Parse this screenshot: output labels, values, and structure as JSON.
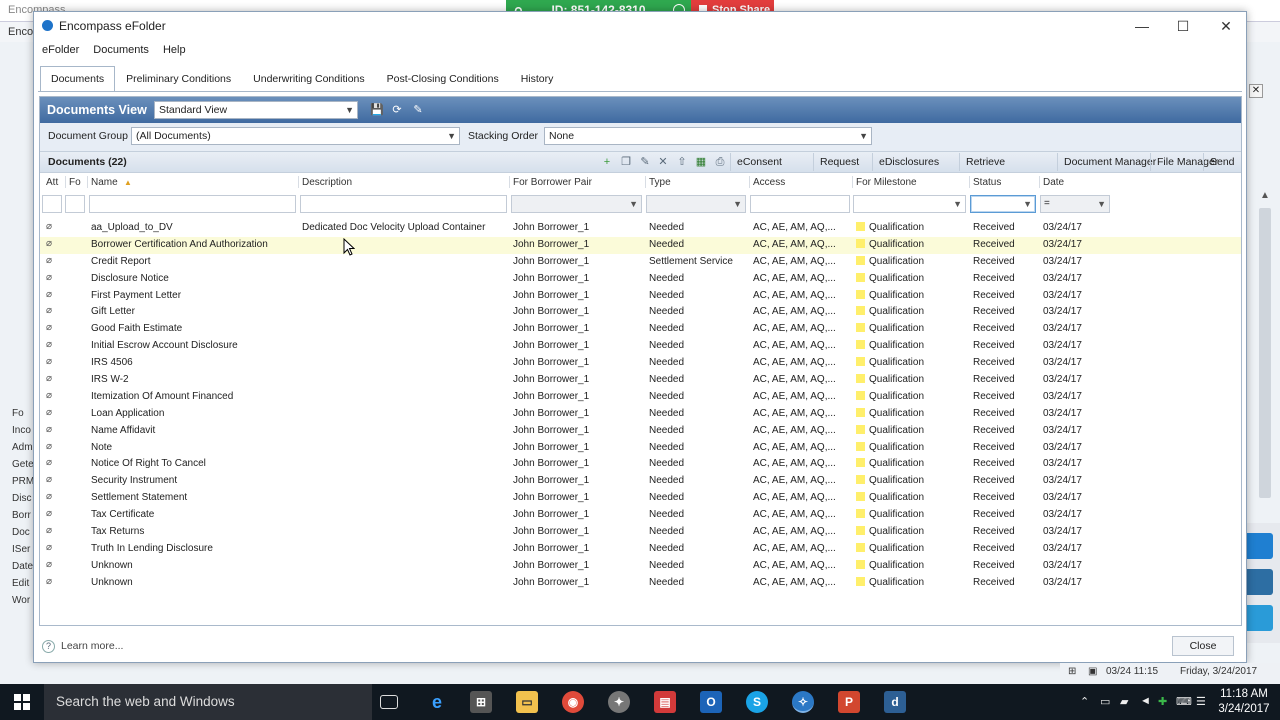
{
  "background": {
    "title": "Encompass",
    "menu_first": "Enco",
    "side_items": [
      "Fo",
      "Inco",
      "Adm",
      "Gete",
      "PRM",
      "Disc",
      "Borr",
      "Doc",
      "ISer",
      "Date",
      "Edit",
      "Wor"
    ]
  },
  "share": {
    "id_label": "ID: 851-142-8310",
    "stop_label": "Stop Share"
  },
  "window": {
    "title": "Encompass eFolder",
    "menu": [
      "eFolder",
      "Documents",
      "Help"
    ],
    "tabs": [
      "Documents",
      "Preliminary Conditions",
      "Underwriting Conditions",
      "Post-Closing Conditions",
      "History"
    ]
  },
  "documents_view": {
    "title": "Documents View",
    "view_select": "Standard View",
    "document_group_label": "Document Group",
    "document_group_value": "(All Documents)",
    "stacking_order_label": "Stacking Order",
    "stacking_order_value": "None"
  },
  "docs_bar": {
    "title": "Documents (22)",
    "buttons": [
      "eConsent",
      "Request",
      "eDisclosures",
      "Retrieve",
      "Document Manager",
      "File Manager",
      "Send"
    ]
  },
  "columns": [
    "Att",
    "Fo",
    "Name",
    "Description",
    "For Borrower Pair",
    "Type",
    "Access",
    "For Milestone",
    "Status",
    "Date"
  ],
  "filter": {
    "date_operator": "="
  },
  "rows": [
    {
      "name": "aa_Upload_to_DV",
      "description": "Dedicated Doc Velocity Upload Container",
      "borrower": "John Borrower_1",
      "type": "Needed",
      "access": "AC, AE, AM, AQ,...",
      "milestone": "Qualification",
      "status": "Received",
      "date": "03/24/17"
    },
    {
      "name": "Borrower Certification And Authorization",
      "description": "",
      "borrower": "John Borrower_1",
      "type": "Needed",
      "access": "AC, AE, AM, AQ,...",
      "milestone": "Qualification",
      "status": "Received",
      "date": "03/24/17"
    },
    {
      "name": "Credit Report",
      "description": "",
      "borrower": "John Borrower_1",
      "type": "Settlement Service",
      "access": "AC, AE, AM, AQ,...",
      "milestone": "Qualification",
      "status": "Received",
      "date": "03/24/17"
    },
    {
      "name": "Disclosure Notice",
      "description": "",
      "borrower": "John Borrower_1",
      "type": "Needed",
      "access": "AC, AE, AM, AQ,...",
      "milestone": "Qualification",
      "status": "Received",
      "date": "03/24/17"
    },
    {
      "name": "First Payment Letter",
      "description": "",
      "borrower": "John Borrower_1",
      "type": "Needed",
      "access": "AC, AE, AM, AQ,...",
      "milestone": "Qualification",
      "status": "Received",
      "date": "03/24/17"
    },
    {
      "name": "Gift Letter",
      "description": "",
      "borrower": "John Borrower_1",
      "type": "Needed",
      "access": "AC, AE, AM, AQ,...",
      "milestone": "Qualification",
      "status": "Received",
      "date": "03/24/17"
    },
    {
      "name": "Good Faith Estimate",
      "description": "",
      "borrower": "John Borrower_1",
      "type": "Needed",
      "access": "AC, AE, AM, AQ,...",
      "milestone": "Qualification",
      "status": "Received",
      "date": "03/24/17"
    },
    {
      "name": "Initial Escrow Account Disclosure",
      "description": "",
      "borrower": "John Borrower_1",
      "type": "Needed",
      "access": "AC, AE, AM, AQ,...",
      "milestone": "Qualification",
      "status": "Received",
      "date": "03/24/17"
    },
    {
      "name": "IRS 4506",
      "description": "",
      "borrower": "John Borrower_1",
      "type": "Needed",
      "access": "AC, AE, AM, AQ,...",
      "milestone": "Qualification",
      "status": "Received",
      "date": "03/24/17"
    },
    {
      "name": "IRS W-2",
      "description": "",
      "borrower": "John Borrower_1",
      "type": "Needed",
      "access": "AC, AE, AM, AQ,...",
      "milestone": "Qualification",
      "status": "Received",
      "date": "03/24/17"
    },
    {
      "name": "Itemization Of Amount Financed",
      "description": "",
      "borrower": "John Borrower_1",
      "type": "Needed",
      "access": "AC, AE, AM, AQ,...",
      "milestone": "Qualification",
      "status": "Received",
      "date": "03/24/17"
    },
    {
      "name": "Loan Application",
      "description": "",
      "borrower": "John Borrower_1",
      "type": "Needed",
      "access": "AC, AE, AM, AQ,...",
      "milestone": "Qualification",
      "status": "Received",
      "date": "03/24/17"
    },
    {
      "name": "Name Affidavit",
      "description": "",
      "borrower": "John Borrower_1",
      "type": "Needed",
      "access": "AC, AE, AM, AQ,...",
      "milestone": "Qualification",
      "status": "Received",
      "date": "03/24/17"
    },
    {
      "name": "Note",
      "description": "",
      "borrower": "John Borrower_1",
      "type": "Needed",
      "access": "AC, AE, AM, AQ,...",
      "milestone": "Qualification",
      "status": "Received",
      "date": "03/24/17"
    },
    {
      "name": "Notice Of Right To Cancel",
      "description": "",
      "borrower": "John Borrower_1",
      "type": "Needed",
      "access": "AC, AE, AM, AQ,...",
      "milestone": "Qualification",
      "status": "Received",
      "date": "03/24/17"
    },
    {
      "name": "Security Instrument",
      "description": "",
      "borrower": "John Borrower_1",
      "type": "Needed",
      "access": "AC, AE, AM, AQ,...",
      "milestone": "Qualification",
      "status": "Received",
      "date": "03/24/17"
    },
    {
      "name": "Settlement Statement",
      "description": "",
      "borrower": "John Borrower_1",
      "type": "Needed",
      "access": "AC, AE, AM, AQ,...",
      "milestone": "Qualification",
      "status": "Received",
      "date": "03/24/17"
    },
    {
      "name": "Tax Certificate",
      "description": "",
      "borrower": "John Borrower_1",
      "type": "Needed",
      "access": "AC, AE, AM, AQ,...",
      "milestone": "Qualification",
      "status": "Received",
      "date": "03/24/17"
    },
    {
      "name": "Tax Returns",
      "description": "",
      "borrower": "John Borrower_1",
      "type": "Needed",
      "access": "AC, AE, AM, AQ,...",
      "milestone": "Qualification",
      "status": "Received",
      "date": "03/24/17"
    },
    {
      "name": "Truth In Lending Disclosure",
      "description": "",
      "borrower": "John Borrower_1",
      "type": "Needed",
      "access": "AC, AE, AM, AQ,...",
      "milestone": "Qualification",
      "status": "Received",
      "date": "03/24/17"
    },
    {
      "name": "Unknown",
      "description": "",
      "borrower": "John Borrower_1",
      "type": "Needed",
      "access": "AC, AE, AM, AQ,...",
      "milestone": "Qualification",
      "status": "Received",
      "date": "03/24/17"
    },
    {
      "name": "Unknown",
      "description": "",
      "borrower": "John Borrower_1",
      "type": "Needed",
      "access": "AC, AE, AM, AQ,...",
      "milestone": "Qualification",
      "status": "Received",
      "date": "03/24/17"
    }
  ],
  "selected_row": 1,
  "footer": {
    "learn_more": "Learn more...",
    "close": "Close"
  },
  "status_strip": {
    "timestamp": "03/24 11:15",
    "date": "Friday, 3/24/2017"
  },
  "taskbar": {
    "search": "Search the web and Windows",
    "time": "11:18 AM",
    "date": "3/24/2017"
  },
  "colors": {
    "header_blue": "#3f6aa0",
    "share_green": "#2fa84f",
    "stop_red": "#e23d3d",
    "milestone_swatch": "#ffef6b",
    "selected_row": "#fbfbd9"
  }
}
